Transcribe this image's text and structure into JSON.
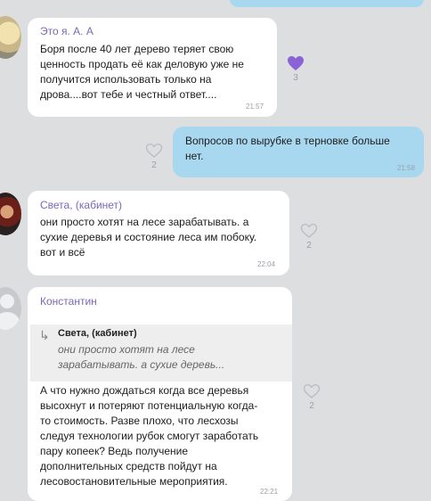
{
  "messages": [
    {
      "sender": "Это я. А. А",
      "text_lines": [
        "Боря после 40 лет дерево теряет свою",
        "ценность продать её как деловую уже не",
        "получится использовать только на",
        "дрова....вот тебе и честный ответ...."
      ],
      "time": "21:57",
      "likes": "3",
      "liked": true
    },
    {
      "sender": "",
      "text_lines": [
        "Вопросов по вырубке в терновке больше",
        "нет."
      ],
      "time": "21:58",
      "likes": "2",
      "liked": false
    },
    {
      "sender": "Света, (кабинет)",
      "text_lines": [
        "они просто хотят на лесе зарабатывать. а",
        "сухие деревья и состояние леса им побоку.",
        "вот и всё"
      ],
      "time": "22:04",
      "likes": "2",
      "liked": false
    },
    {
      "sender": "Константин",
      "quote": {
        "name": "Света, (кабинет)",
        "text_lines": [
          "они просто хотят на лесе",
          "зарабатывать. а сухие деревь..."
        ]
      },
      "text_lines": [
        "А что нужно дождаться когда все деревья",
        "высохнут и потеряют потенциальную когда-",
        "то стоимость. Разве плохо, что лесхозы",
        "следуя технологии рубок смогут заработать",
        "пару копеек? Ведь получение",
        "дополнительных средств пойдут на",
        "лесовостановительные мероприятия."
      ],
      "time": "22:21",
      "likes": "2",
      "liked": false
    }
  ],
  "colors": {
    "background": "#dcdee0",
    "incoming_bubble": "#ffffff",
    "outgoing_bubble": "#a8d8ef",
    "sender_name": "#7b68b5",
    "liked_heart": "#8b63d6"
  }
}
